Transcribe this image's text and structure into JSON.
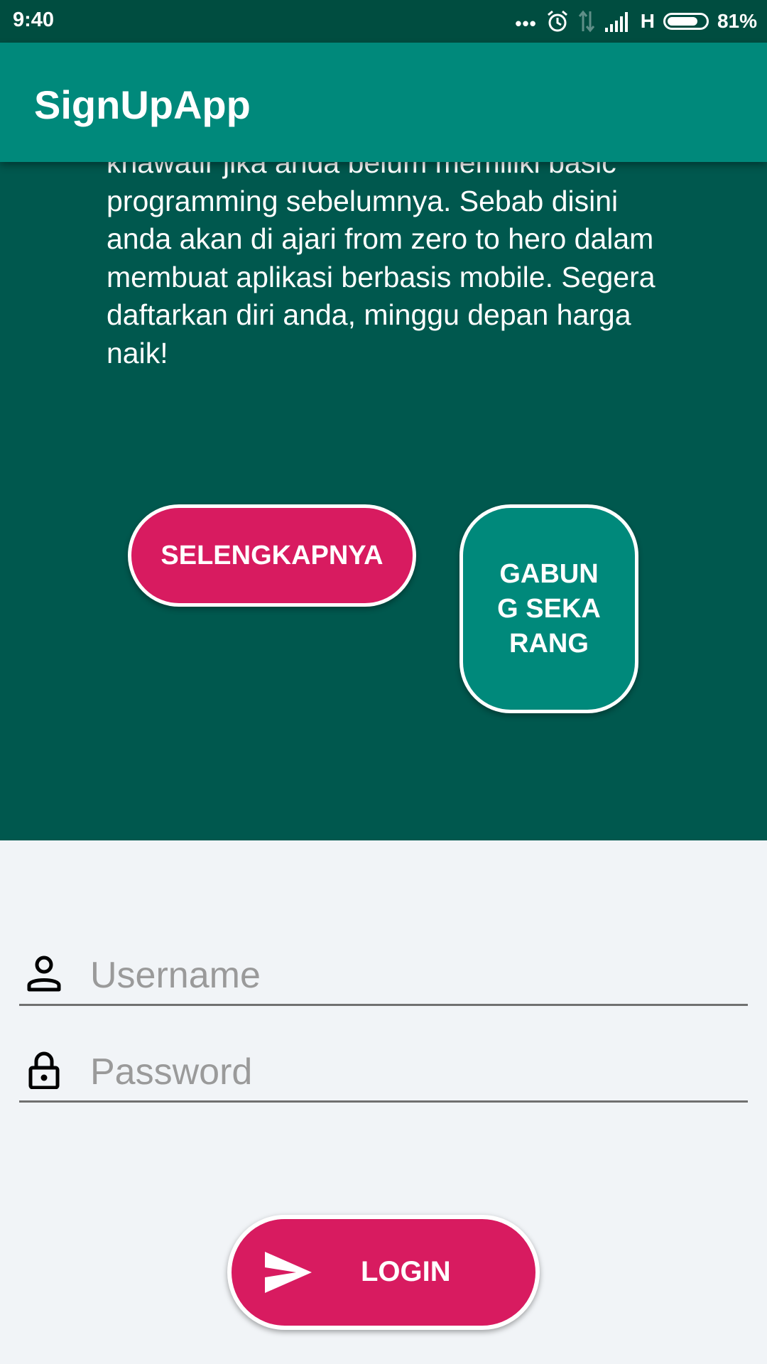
{
  "status_bar": {
    "time": "9:40",
    "network_type": "H",
    "battery_percent": "81%",
    "battery_level": 0.81,
    "icons": [
      "more-dots-icon",
      "alarm-icon",
      "data-arrows-icon",
      "signal-icon",
      "battery-icon"
    ]
  },
  "app_bar": {
    "title": "SignUpApp"
  },
  "hero": {
    "description": "khawatir jika anda belum memiliki basic programming sebelumnya. Sebab disini anda akan di ajari from zero to hero dalam membuat aplikasi berbasis mobile. Segera daftarkan diri anda, minggu depan harga naik!",
    "more_button_label": "SELENGKAPNYA",
    "join_button_label": "GABUNG SEKARANG"
  },
  "form": {
    "username": {
      "value": "",
      "placeholder": "Username",
      "icon": "person-icon"
    },
    "password": {
      "value": "",
      "placeholder": "Password",
      "icon": "lock-icon"
    },
    "login_button_label": "LOGIN",
    "login_icon": "send-icon"
  },
  "colors": {
    "status_bar": "#004d40",
    "app_bar": "#00897b",
    "hero_background": "#00584e",
    "accent_pink": "#d81b60",
    "join_button": "#00897b",
    "form_background": "#f1f4f7"
  }
}
